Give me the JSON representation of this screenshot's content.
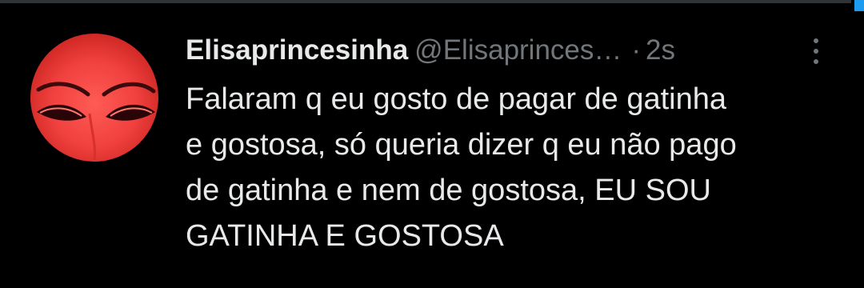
{
  "tweet": {
    "display_name": "Elisaprincesinha",
    "handle": "@Elisaprinces…",
    "separator": "·",
    "timestamp": "2s",
    "text": "Falaram q eu gosto de pagar de gatinha\ne gostosa, só queria dizer q eu não pago\nde gatinha e nem de gostosa, EU SOU\nGATINHA E GOSTOSA",
    "more_icon": "more-vertical-icon"
  },
  "colors": {
    "background": "#000000",
    "text_primary": "#e7e9ea",
    "text_secondary": "#71767b",
    "avatar_tint": "#f0413f",
    "accent": "#1d9bf0"
  }
}
